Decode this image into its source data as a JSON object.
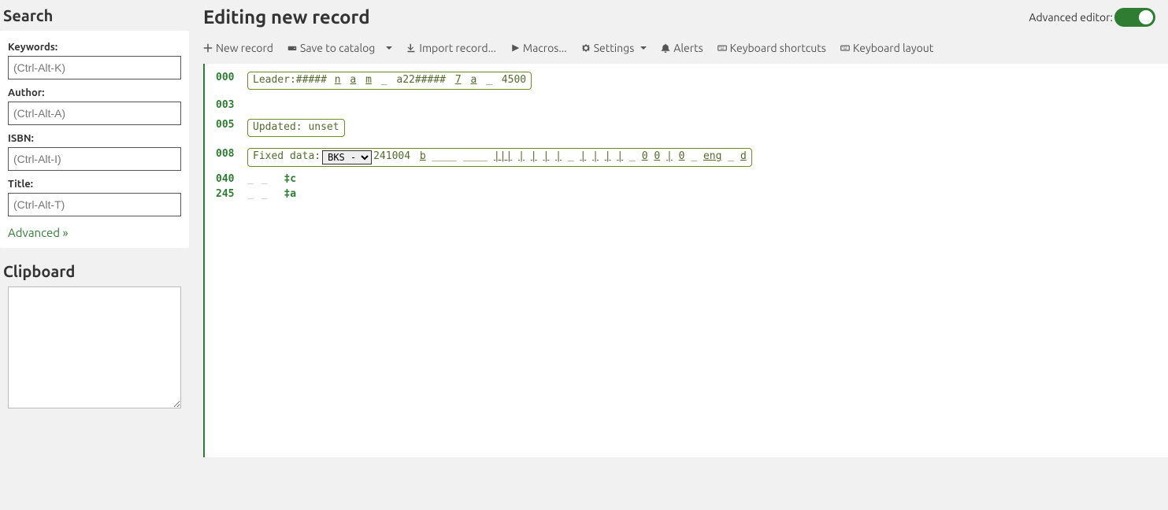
{
  "sidebar": {
    "search_heading": "Search",
    "fields": {
      "keywords_label": "Keywords:",
      "keywords_placeholder": "(Ctrl-Alt-K)",
      "author_label": "Author:",
      "author_placeholder": "(Ctrl-Alt-A)",
      "isbn_label": "ISBN:",
      "isbn_placeholder": "(Ctrl-Alt-I)",
      "title_label": "Title:",
      "title_placeholder": "(Ctrl-Alt-T)"
    },
    "advanced_link": "Advanced »",
    "clipboard_heading": "Clipboard"
  },
  "header": {
    "title": "Editing new record",
    "adv_editor_label": "Advanced editor:",
    "adv_editor_on": true
  },
  "toolbar": {
    "new_record": "New record",
    "save_catalog": "Save to catalog",
    "import_record": "Import record...",
    "macros": "Macros...",
    "settings": "Settings",
    "alerts": "Alerts",
    "shortcuts": "Keyboard shortcuts",
    "layout": "Keyboard layout"
  },
  "marc": {
    "l000_tag": "000",
    "l000_prefix": "Leader:##### ",
    "l000_parts": [
      "n",
      "a",
      "m",
      "_",
      "a22#####",
      "7",
      "a",
      "_",
      "4500"
    ],
    "l003_tag": "003",
    "l005_tag": "005",
    "l005_text": "Updated: unset",
    "l008_tag": "008",
    "l008_prefix": "Fixed data:",
    "l008_select": "BKS  -",
    "l008_after_select": " 241004",
    "l008_parts": [
      "b",
      "____",
      "____",
      "|||",
      "|",
      "|",
      "|",
      "|",
      "_",
      "|",
      "|",
      "|",
      "|",
      "_",
      "0",
      "0",
      "|",
      "0",
      "_",
      "eng",
      "_",
      "d"
    ],
    "l040_tag": "040",
    "l040_ind": "_ _",
    "l040_sf": "‡c",
    "l245_tag": "245",
    "l245_ind": "_ _",
    "l245_sf": "‡a"
  }
}
